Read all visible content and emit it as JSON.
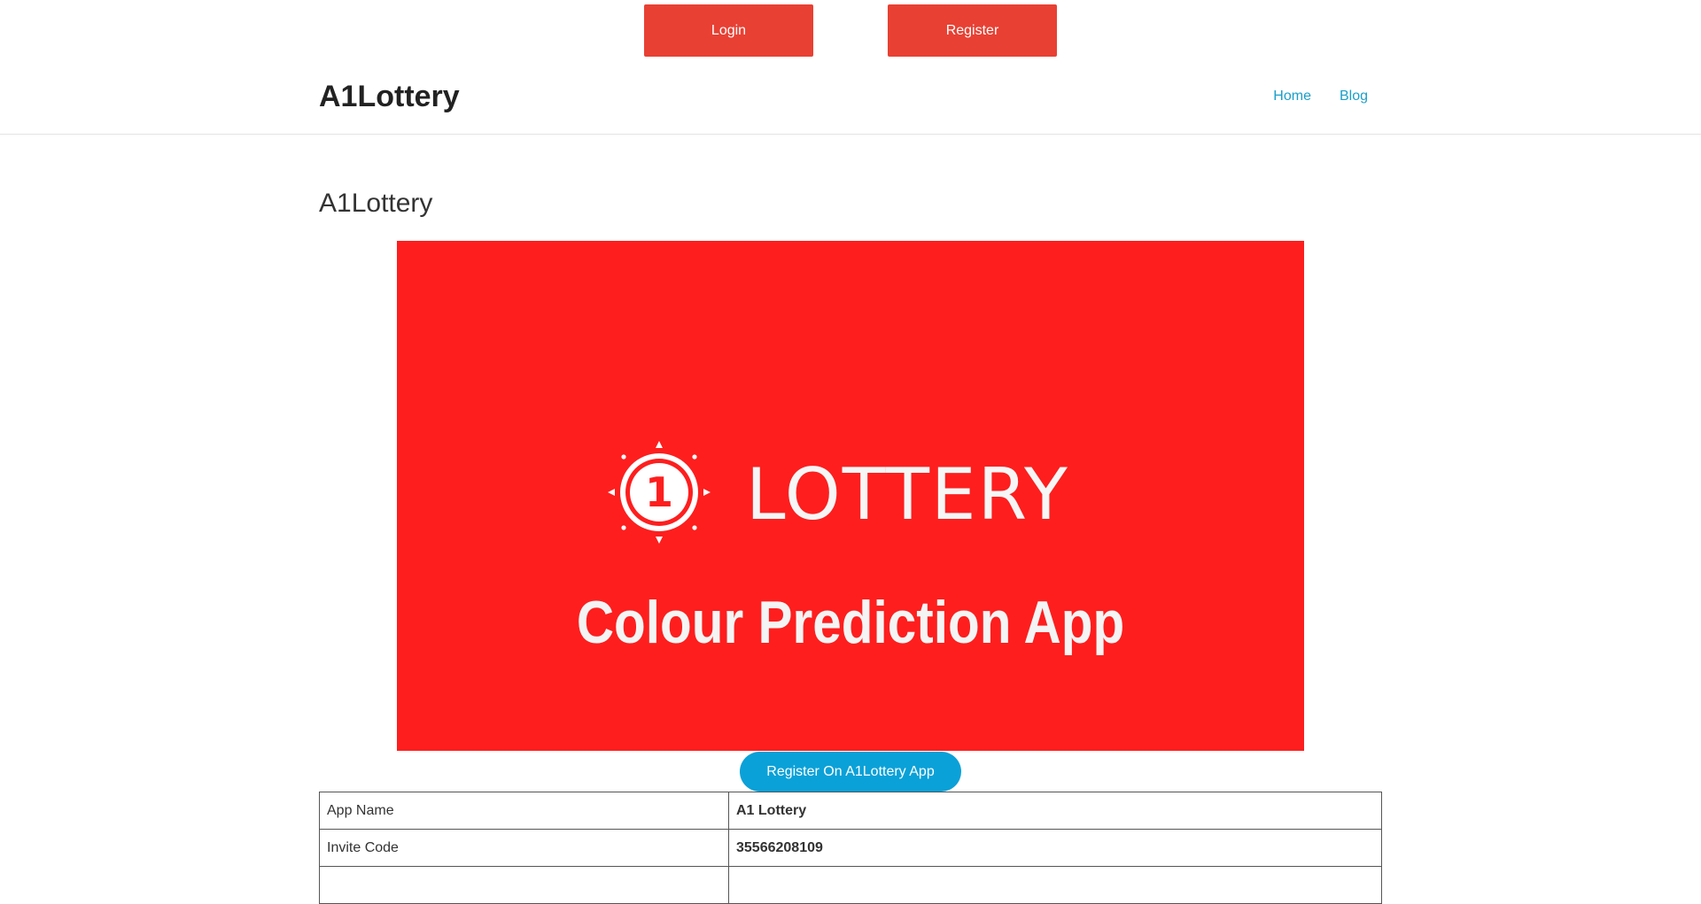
{
  "top_buttons": {
    "login_label": "Login",
    "register_label": "Register"
  },
  "header": {
    "brand": "A1Lottery",
    "nav": [
      {
        "label": "Home"
      },
      {
        "label": "Blog"
      }
    ]
  },
  "main": {
    "title": "A1Lottery",
    "hero": {
      "brand_text": "LOTTERY",
      "emblem_text": "1",
      "tagline": "Colour Prediction App"
    },
    "cta_label": "Register On A1Lottery App",
    "table": {
      "rows": [
        {
          "key": "App Name",
          "value": "A1 Lottery"
        },
        {
          "key": "Invite Code",
          "value": "35566208109"
        },
        {
          "key": "",
          "value": ""
        }
      ]
    }
  },
  "colors": {
    "accent_red": "#e84033",
    "hero_red": "#fe1e1e",
    "link_blue": "#1a9fc9",
    "cta_blue": "#0aa1d8"
  }
}
